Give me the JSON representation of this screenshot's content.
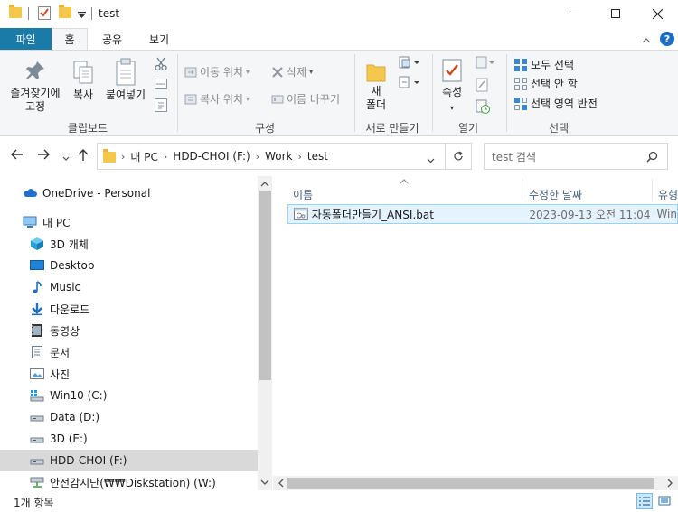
{
  "window": {
    "title": "test"
  },
  "ribbon": {
    "tabs": {
      "file": "파일",
      "home": "홈",
      "share": "공유",
      "view": "보기"
    },
    "clipboard": {
      "pin_label": "즐겨찾기에\n고정",
      "copy_label": "복사",
      "paste_label": "붙여넣기",
      "group_label": "클립보드"
    },
    "organize": {
      "move_to": "이동 위치",
      "copy_to": "복사 위치",
      "delete": "삭제",
      "rename": "이름 바꾸기",
      "group_label": "구성"
    },
    "new": {
      "new_folder": "새\n폴더",
      "group_label": "새로 만들기"
    },
    "open": {
      "properties": "속성",
      "group_label": "열기"
    },
    "select": {
      "select_all": "모두 선택",
      "select_none": "선택 안 함",
      "invert": "선택 영역 반전",
      "group_label": "선택"
    }
  },
  "address": {
    "crumbs": [
      "내 PC",
      "HDD-CHOI (F:)",
      "Work",
      "test"
    ],
    "search_placeholder": "test 검색"
  },
  "nav": {
    "items": [
      {
        "label": "OneDrive - Personal",
        "icon": "cloud-icon"
      },
      {
        "label": "내 PC",
        "icon": "computer-icon"
      },
      {
        "label": "3D 개체",
        "icon": "cube-icon"
      },
      {
        "label": "Desktop",
        "icon": "desktop-icon"
      },
      {
        "label": "Music",
        "icon": "music-icon"
      },
      {
        "label": "다운로드",
        "icon": "download-icon"
      },
      {
        "label": "동영상",
        "icon": "video-icon"
      },
      {
        "label": "문서",
        "icon": "document-icon"
      },
      {
        "label": "사진",
        "icon": "picture-icon"
      },
      {
        "label": "Win10 (C:)",
        "icon": "windows-drive-icon"
      },
      {
        "label": "Data (D:)",
        "icon": "drive-icon"
      },
      {
        "label": "3D (E:)",
        "icon": "drive-icon"
      },
      {
        "label": "HDD-CHOI (F:)",
        "icon": "drive-icon"
      },
      {
        "label": "안전감시단(₩₩Diskstation) (W:)",
        "icon": "network-drive-icon"
      }
    ]
  },
  "filelist": {
    "columns": {
      "name": "이름",
      "modified": "수정한 날짜",
      "type": "유형"
    },
    "rows": [
      {
        "name": "자동폴더만들기_ANSI.bat",
        "modified": "2023-09-13 오전 11:04",
        "type": "Win"
      }
    ]
  },
  "status": {
    "count": "1개 항목"
  }
}
